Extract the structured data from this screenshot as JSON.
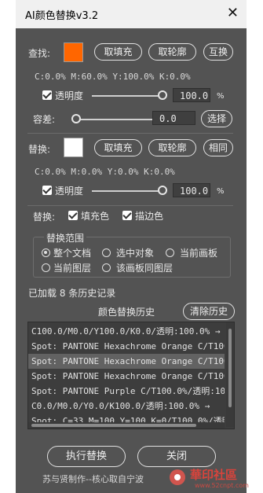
{
  "window": {
    "title": "AI颜色替换v3.2",
    "close_glyph": "✕"
  },
  "find": {
    "label": "查找:",
    "swatch_color": "#ff6600",
    "btn_fill": "取填充",
    "btn_stroke": "取轮廓",
    "btn_swap": "互换",
    "cmyk": "C:0.0% M:60.0% Y:100.0% K:0.0%",
    "opacity_label": "透明度",
    "opacity_value": "100.0",
    "opacity_unit": "%",
    "tolerance_label": "容差:",
    "tolerance_value": "0.0",
    "select_btn": "选择"
  },
  "replace": {
    "label": "替换:",
    "swatch_color": "#ffffff",
    "btn_fill": "取填充",
    "btn_stroke": "取轮廓",
    "btn_same": "相同",
    "cmyk": "C:0.0% M:0.0% Y:0.0% K:0.0%",
    "opacity_label": "透明度",
    "opacity_value": "100.0",
    "opacity_unit": "%",
    "target_label": "替换:",
    "fill_label": "填充色",
    "stroke_label": "描边色"
  },
  "scope": {
    "title": "替换范围",
    "options": [
      "整个文档",
      "选中对象",
      "当前画板",
      "当前图层",
      "该画板同图层"
    ],
    "selected": "整个文档"
  },
  "history": {
    "loaded_text": "已加载 8 条历史记录",
    "title": "颜色替换历史",
    "clear_btn": "清除历史",
    "rows": [
      "C100.0/M0.0/Y100.0/K0.0/透明:100.0% →",
      "Spot: PANTONE Hexachrome Orange C/T100",
      "Spot: PANTONE Hexachrome Orange C/T100",
      "Spot: PANTONE Hexachrome Orange C/T100",
      "Spot: PANTONE Purple C/T100.0%/透明:10",
      "C0.0/M0.0/Y0.0/K100.0/透明:100.0% →",
      "Spot: C=33 M=100 Y=100 K=0/T100.0%/透明"
    ]
  },
  "actions": {
    "execute": "执行替换",
    "close": "关闭"
  },
  "footer": "苏与贤制作--核心取自宁波",
  "watermark": "華印社區",
  "watermark_sub": "www.52cnpt.com",
  "colors": {
    "panel": "#535353",
    "accent_orange": "#ff6600"
  }
}
